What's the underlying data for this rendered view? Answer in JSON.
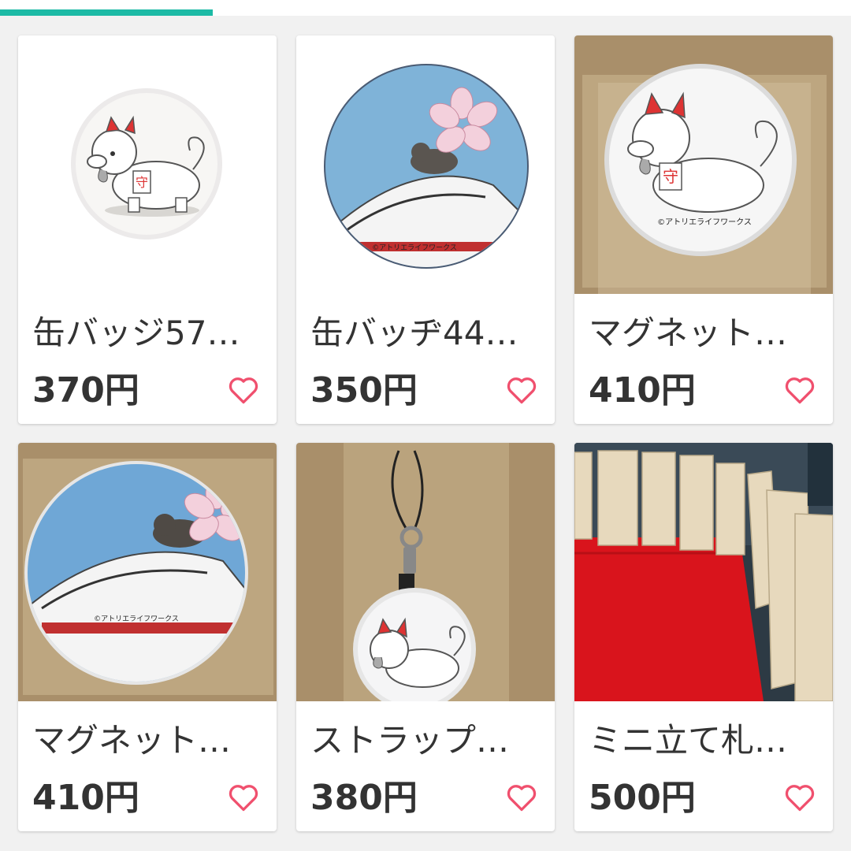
{
  "progress": {
    "fraction": 0.25,
    "color": "#1cbaa5"
  },
  "items": [
    {
      "title": "缶バッジ57…",
      "price": "370円",
      "image": "white-komainu-dog-badge"
    },
    {
      "title": "缶バッヂ44…",
      "price": "350円",
      "image": "shinkansen-cat-badge"
    },
    {
      "title": "マグネット…",
      "price": "410円",
      "image": "white-komainu-dog-magnet-packaged"
    },
    {
      "title": "マグネット…",
      "price": "410円",
      "image": "shinkansen-cat-magnet-packaged"
    },
    {
      "title": "ストラップ…",
      "price": "380円",
      "image": "white-dog-strap-packaged"
    },
    {
      "title": "ミニ立て札…",
      "price": "500円",
      "image": "wooden-mini-signboards-red-cloth"
    }
  ],
  "badge_credit": "©アトリエライフワークス",
  "like_icon_color": "#f0506e"
}
